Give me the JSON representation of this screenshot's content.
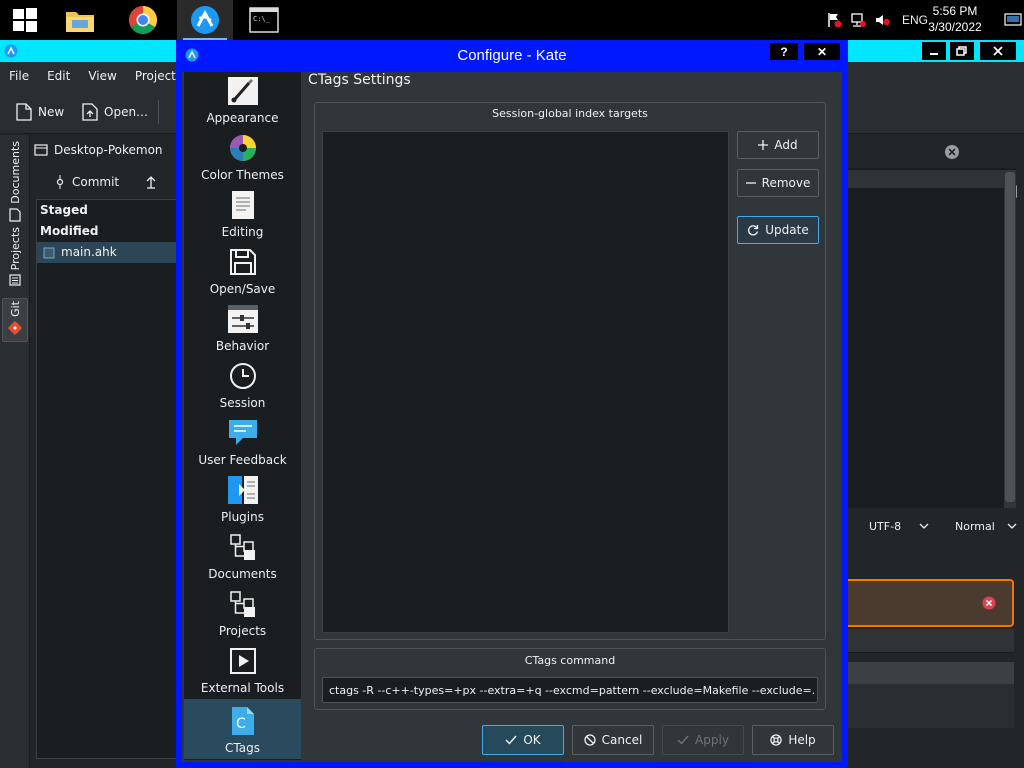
{
  "taskbar": {
    "apps": [
      {
        "name": "windows-start",
        "active": false
      },
      {
        "name": "file-explorer",
        "active": false
      },
      {
        "name": "chrome",
        "active": false
      },
      {
        "name": "kate",
        "active": true
      },
      {
        "name": "command-prompt",
        "active": false
      }
    ],
    "language": "ENG",
    "time": "5:56 PM",
    "date": "3/30/2022"
  },
  "kate": {
    "menu": [
      "File",
      "Edit",
      "View",
      "Projects"
    ],
    "toolbar": {
      "new_label": "New",
      "open_label": "Open…"
    },
    "rail_tabs": [
      "Documents",
      "Projects",
      "Git"
    ],
    "git": {
      "repo": "Desktop-Pokemon",
      "commit_label": "Commit",
      "staged_header": "Staged",
      "modified_header": "Modified",
      "files": [
        "main.ahk"
      ]
    },
    "status": {
      "encoding": "UTF-8",
      "mode": "Normal"
    }
  },
  "dialog": {
    "title": "Configure - Kate",
    "help_glyph": "?",
    "close_glyph": "✕",
    "pages": [
      {
        "label": "Appearance",
        "icon": "paintbrush-icon"
      },
      {
        "label": "Color Themes",
        "icon": "color-wheel-icon"
      },
      {
        "label": "Editing",
        "icon": "document-icon"
      },
      {
        "label": "Open/Save",
        "icon": "save-icon"
      },
      {
        "label": "Behavior",
        "icon": "sliders-icon"
      },
      {
        "label": "Session",
        "icon": "clock-icon"
      },
      {
        "label": "User Feedback",
        "icon": "speech-bubble-icon"
      },
      {
        "label": "Plugins",
        "icon": "plugin-icon"
      },
      {
        "label": "Documents",
        "icon": "tree-icon"
      },
      {
        "label": "Projects",
        "icon": "tree-icon"
      },
      {
        "label": "External Tools",
        "icon": "play-icon"
      },
      {
        "label": "CTags",
        "icon": "ctags-icon"
      }
    ],
    "selected_page": "CTags",
    "settings_title": "CTags Settings",
    "targets_group_title": "Session-global index targets",
    "add_label": "Add",
    "remove_label": "Remove",
    "update_label": "Update",
    "command_group_title": "CTags command",
    "command_value": "ctags -R --c++-types=+px --extra=+q --excmd=pattern --exclude=Makefile --exclude=.",
    "buttons": {
      "ok": "OK",
      "cancel": "Cancel",
      "apply": "Apply",
      "help": "Help"
    }
  },
  "colors": {
    "accent": "#3daee9",
    "dialog_frame": "#0018ff",
    "kate_titlebar": "#00e6ff",
    "warning_border": "#f67400"
  }
}
